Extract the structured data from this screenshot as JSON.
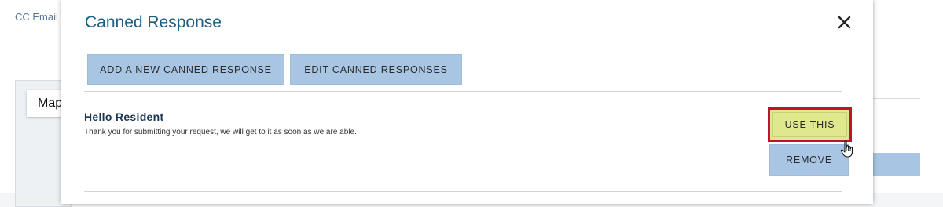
{
  "background": {
    "cc_label": "CC Email",
    "map_button_label": "Map"
  },
  "modal": {
    "title": "Canned Response",
    "close_icon": "close-icon",
    "toolbar": {
      "add_label": "ADD A NEW CANNED RESPONSE",
      "edit_label": "EDIT CANNED RESPONSES"
    },
    "responses": [
      {
        "title": "Hello Resident",
        "body": "Thank you for submitting your request, we will get to it as soon as we are able.",
        "use_label": "USE THIS",
        "remove_label": "REMOVE"
      }
    ]
  },
  "colors": {
    "title": "#1b5f86",
    "button_bg": "#a8c6e3",
    "highlight_bg": "#e0e88e",
    "highlight_border": "#c0132a"
  }
}
